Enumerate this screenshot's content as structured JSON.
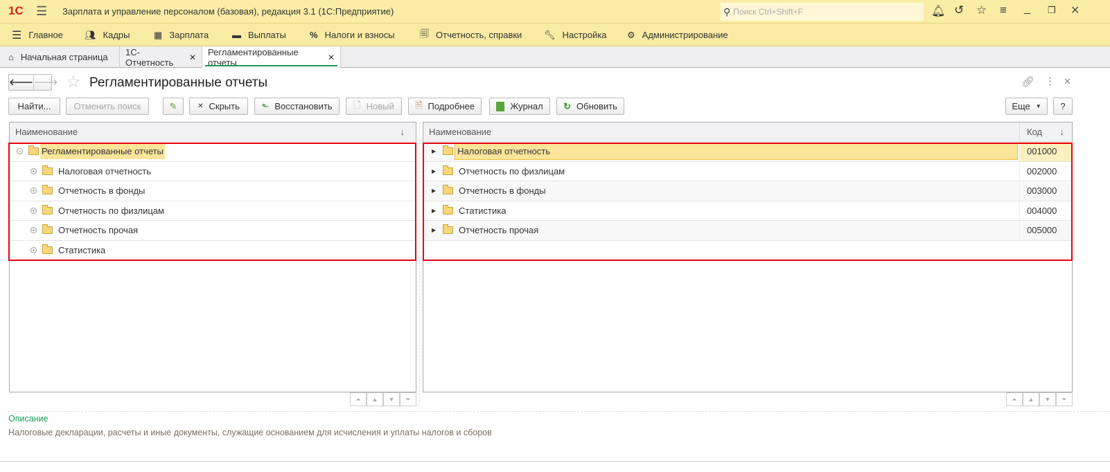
{
  "app": {
    "logo": "1С",
    "title": "Зарплата и управление персоналом (базовая), редакция 3.1  (1С:Предприятие)",
    "search_placeholder": "Поиск Ctrl+Shift+F"
  },
  "sections": [
    {
      "label": "Главное",
      "icon": "menu-icon"
    },
    {
      "label": "Кадры",
      "icon": "people-icon"
    },
    {
      "label": "Зарплата",
      "icon": "calculator-icon"
    },
    {
      "label": "Выплаты",
      "icon": "wallet-icon"
    },
    {
      "label": "Налоги и взносы",
      "icon": "percent-icon"
    },
    {
      "label": "Отчетность, справки",
      "icon": "report-icon"
    },
    {
      "label": "Настройка",
      "icon": "wrench-icon"
    },
    {
      "label": "Администрирование",
      "icon": "gear-icon"
    }
  ],
  "tabs": [
    {
      "label": "Начальная страница"
    },
    {
      "label": "1С-Отчетность"
    },
    {
      "label": "Регламентированные отчеты",
      "active": true
    }
  ],
  "form": {
    "title": "Регламентированные отчеты"
  },
  "toolbar": {
    "find": "Найти...",
    "cancel_search": "Отменить поиск",
    "hide": "Скрыть",
    "restore": "Восстановить",
    "new": "Новый",
    "details": "Подробнее",
    "journal": "Журнал",
    "refresh": "Обновить",
    "more": "Еще",
    "help": "?"
  },
  "left_tree": {
    "column": "Наименование",
    "sort": "↓",
    "root": "Регламентированные отчеты",
    "items": [
      "Налоговая отчетность",
      "Отчетность в фонды",
      "Отчетность по физлицам",
      "Отчетность прочая",
      "Статистика"
    ]
  },
  "right_list": {
    "columns": {
      "name": "Наименование",
      "code": "Код",
      "sort": "↓"
    },
    "rows": [
      {
        "name": "Налоговая отчетность",
        "code": "001000"
      },
      {
        "name": "Отчетность по физлицам",
        "code": "002000"
      },
      {
        "name": "Отчетность в фонды",
        "code": "003000"
      },
      {
        "name": "Статистика",
        "code": "004000"
      },
      {
        "name": "Отчетность прочая",
        "code": "005000"
      }
    ]
  },
  "description": {
    "label": "Описание",
    "text": "Налоговые декларации, расчеты и иные документы, служащие основанием для исчисления и уплаты налогов и сборов"
  },
  "colors": {
    "accent_yellow": "#fbeda6",
    "selection": "#fbe59a",
    "highlight_red": "#e4000f",
    "description_green": "#1a9b5b"
  }
}
